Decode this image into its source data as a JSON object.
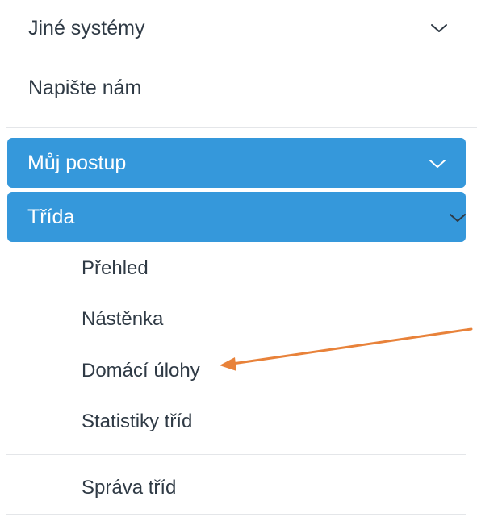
{
  "menu": {
    "other_systems": "Jiné systémy",
    "write_us": "Napište nám",
    "my_progress": "Můj postup",
    "class": "Třída",
    "class_items": [
      "Přehled",
      "Nástěnka",
      "Domácí úlohy",
      "Statistiky tříd"
    ],
    "manage_classes": "Správa tříd"
  },
  "colors": {
    "accent": "#3598db",
    "annotation_arrow": "#e8823a",
    "text": "#2f3a45",
    "divider": "#e4e6e9"
  },
  "icons": {
    "expand": "chevron-down-icon",
    "annotation": "arrow-pointer"
  }
}
